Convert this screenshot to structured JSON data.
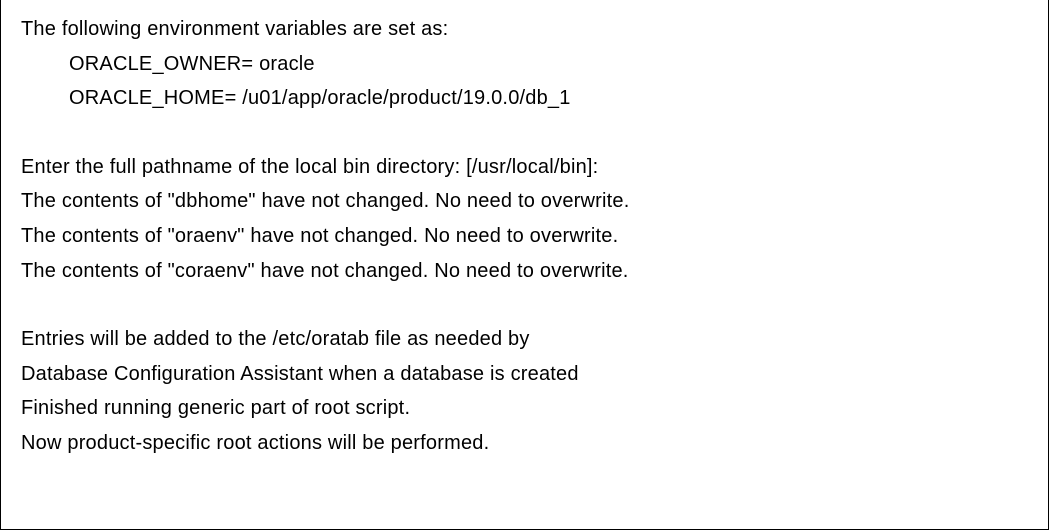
{
  "lines": {
    "env_header": "The following environment variables are set as:",
    "env_owner": "ORACLE_OWNER= oracle",
    "env_home": "ORACLE_HOME=   /u01/app/oracle/product/19.0.0/db_1",
    "prompt_bin": "Enter the full pathname of the local bin directory: [/usr/local/bin]:",
    "dbhome": "The contents of \"dbhome\" have not changed. No need to overwrite.",
    "oraenv": "The contents of \"oraenv\" have not changed. No need to overwrite.",
    "coraenv": "The contents of \"coraenv\" have not changed. No need to overwrite.",
    "oratab1": "Entries will be added to the /etc/oratab file as needed by",
    "oratab2": "Database Configuration Assistant when a database is created",
    "finished": "Finished running generic part of root script.",
    "now": "Now product-specific root actions will be performed."
  }
}
